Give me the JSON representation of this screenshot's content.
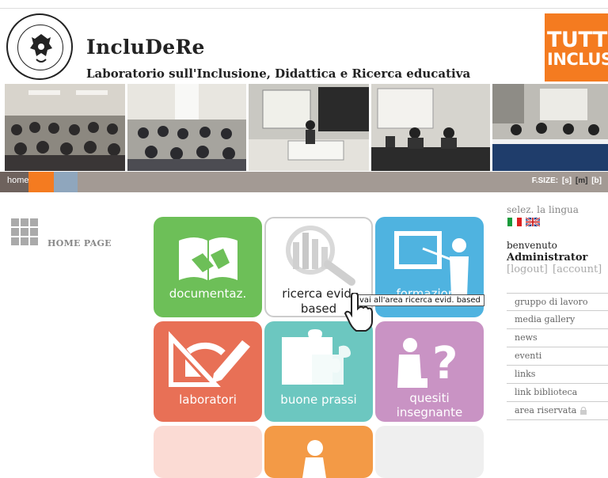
{
  "header": {
    "title": "IncluDeRe",
    "subtitle": "Laboratorio sull'Inclusione, Didattica e Ricerca educativa",
    "logo_text": [
      "TUTTI",
      "INCLUSI"
    ]
  },
  "nav": {
    "home_label": "home",
    "fsize_label": "F.SIZE:",
    "fsize_options": [
      "[s]",
      "[m]",
      "[b]"
    ],
    "fsize_selected": "[m]"
  },
  "sidebar_left": {
    "home_label": "HOME PAGE"
  },
  "tiles": [
    {
      "label": "documentaz.",
      "color": "#6dbf58"
    },
    {
      "label_line1": "ricerca evid.",
      "label_line2": "based",
      "color": "#ffffff"
    },
    {
      "label": "formazione",
      "color": "#4fb3e0"
    },
    {
      "label": "laboratori",
      "color": "#e87056"
    },
    {
      "label": "buone prassi",
      "color": "#6cc7c0"
    },
    {
      "label_line1": "quesiti",
      "label_line2": "insegnante",
      "color": "#c993c4"
    }
  ],
  "tooltip": "vai all'area ricerca evid. based",
  "sidebar_right": {
    "language_label": "selez. la lingua",
    "welcome": "benvenuto",
    "username": "Administrator",
    "logout": "[logout]",
    "account": "[account]",
    "menu": [
      "gruppo di lavoro",
      "media gallery",
      "news",
      "eventi",
      "links",
      "link biblioteca",
      "area riservata"
    ]
  },
  "colors": {
    "accent": "#f47b20",
    "nav_bar": "#a39a94",
    "nav_home": "#6e625d"
  }
}
